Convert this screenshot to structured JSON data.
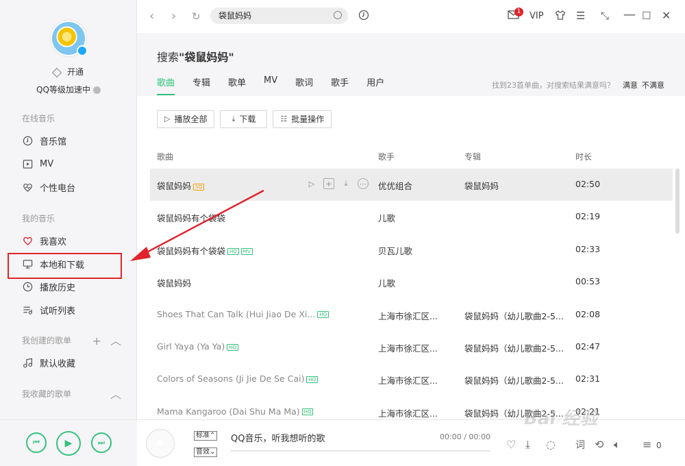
{
  "sidebar": {
    "vip_label": "开通",
    "level_label": "QQ等级加速中",
    "sections": {
      "online": "在线音乐",
      "mine": "我的音乐",
      "created": "我创建的歌单",
      "collected": "我收藏的歌单"
    },
    "items": {
      "music_hall": "音乐馆",
      "mv": "MV",
      "radio": "个性电台",
      "favorites": "我喜欢",
      "local": "本地和下载",
      "history": "播放历史",
      "trial": "试听列表",
      "default_collection": "默认收藏"
    }
  },
  "topbar": {
    "search_value": "袋鼠妈妈",
    "mail_badge": "1",
    "vip": "VIP"
  },
  "search": {
    "prefix": "搜索",
    "keyword": "\"袋鼠妈妈\"",
    "tabs": [
      "歌曲",
      "专辑",
      "歌单",
      "MV",
      "歌词",
      "歌手",
      "用户"
    ],
    "note": "找到23首单曲，对搜索结果满意吗？",
    "satisfied": "满意",
    "unsatisfied": "不满意"
  },
  "toolbar": {
    "play_all": "播放全部",
    "download": "下载",
    "batch": "批量操作"
  },
  "table": {
    "headers": {
      "song": "歌曲",
      "artist": "歌手",
      "album": "专辑",
      "duration": "时长"
    },
    "rows": [
      {
        "name": "袋鼠妈妈",
        "tags": [
          "SQ"
        ],
        "artist": "优优组合",
        "album": "袋鼠妈妈",
        "duration": "02:50"
      },
      {
        "name": "袋鼠妈妈有个袋袋",
        "tags": [],
        "artist": "儿歌",
        "album": "",
        "duration": "02:19"
      },
      {
        "name": "袋鼠妈妈有个袋袋",
        "tags": [
          "HQ",
          "MV"
        ],
        "artist": "贝瓦儿歌",
        "album": "",
        "duration": "02:33"
      },
      {
        "name": "袋鼠妈妈",
        "tags": [],
        "artist": "儿歌",
        "album": "",
        "duration": "00:53"
      },
      {
        "name": "Shoes That Can Talk (Hui Jiao De Xi...",
        "tags": [
          "HQ"
        ],
        "artist": "上海市徐汇区...",
        "album": "袋鼠妈妈（幼儿歌曲2-5...",
        "duration": "02:08"
      },
      {
        "name": "Girl Yaya (Ya Ya)",
        "tags": [
          "HQ"
        ],
        "artist": "上海市徐汇区...",
        "album": "袋鼠妈妈（幼儿歌曲2-5...",
        "duration": "02:47"
      },
      {
        "name": "Colors of Seasons (Ji Jie De Se Cai)",
        "tags": [
          "HQ"
        ],
        "artist": "上海市徐汇区...",
        "album": "袋鼠妈妈（幼儿歌曲2-5...",
        "duration": "02:31"
      },
      {
        "name": "Mama Kangaroo (Dai Shu Ma Ma)",
        "tags": [
          "HQ"
        ],
        "artist": "上海市徐汇区...",
        "album": "袋鼠妈妈（幼儿歌曲2-5...",
        "duration": "02:21"
      }
    ]
  },
  "player": {
    "quality": "标准",
    "effect": "音效",
    "title": "QQ音乐，听我想听的歌",
    "time": "00:00 / 00:00",
    "queue_count": "0"
  },
  "watermark": "Bai 经验"
}
